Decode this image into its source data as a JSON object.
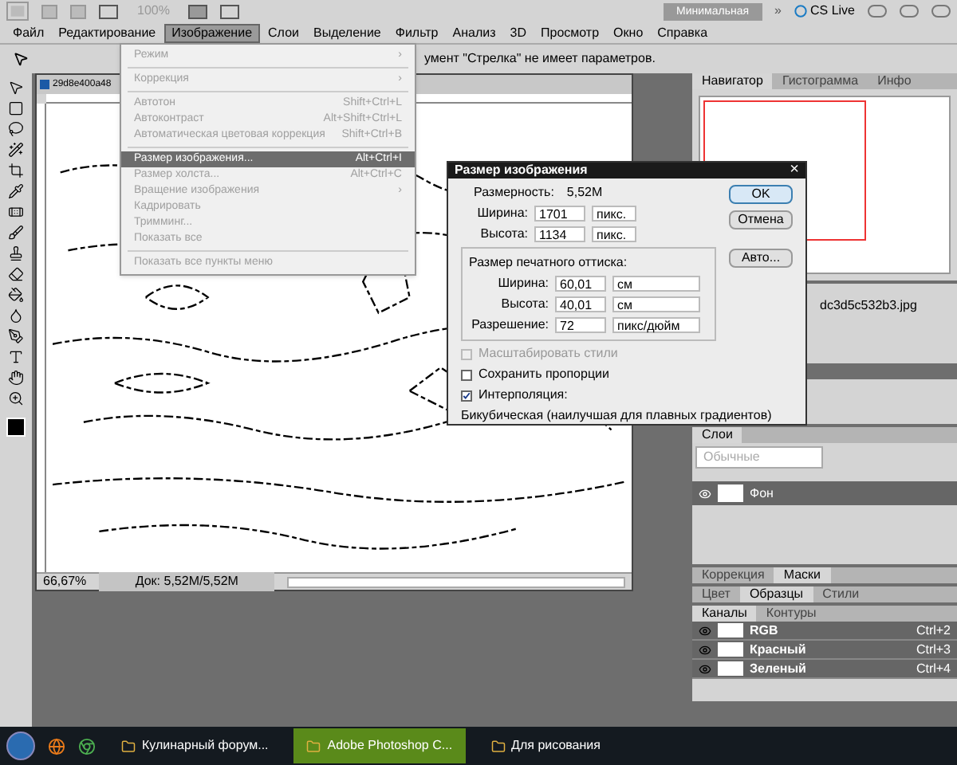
{
  "app_bar": {
    "zoom": "100%",
    "workspace_button": "Минимальная",
    "more": "»",
    "cs_live": "CS Live"
  },
  "menu_bar": [
    {
      "label": "Файл",
      "selected": false
    },
    {
      "label": "Редактирование",
      "selected": false
    },
    {
      "label": "Изображение",
      "selected": true
    },
    {
      "label": "Слои",
      "selected": false
    },
    {
      "label": "Выделение",
      "selected": false
    },
    {
      "label": "Фильтр",
      "selected": false
    },
    {
      "label": "Анализ",
      "selected": false
    },
    {
      "label": "3D",
      "selected": false
    },
    {
      "label": "Просмотр",
      "selected": false
    },
    {
      "label": "Окно",
      "selected": false
    },
    {
      "label": "Справка",
      "selected": false
    }
  ],
  "options_bar": {
    "hint": "умент \"Стрелка\" не имеет параметров."
  },
  "image_menu": [
    {
      "kind": "item",
      "label": "Режим",
      "shortcut": "›",
      "disabled": true,
      "selected": false
    },
    {
      "kind": "separator"
    },
    {
      "kind": "item",
      "label": "Коррекция",
      "shortcut": "›",
      "disabled": true,
      "selected": false
    },
    {
      "kind": "separator"
    },
    {
      "kind": "item",
      "label": "Автотон",
      "shortcut": "Shift+Ctrl+L",
      "disabled": true,
      "selected": false
    },
    {
      "kind": "item",
      "label": "Автоконтраст",
      "shortcut": "Alt+Shift+Ctrl+L",
      "disabled": true,
      "selected": false
    },
    {
      "kind": "item",
      "label": "Автоматическая цветовая коррекция",
      "shortcut": "Shift+Ctrl+B",
      "disabled": true,
      "selected": false
    },
    {
      "kind": "separator"
    },
    {
      "kind": "item",
      "label": "Размер изображения...",
      "shortcut": "Alt+Ctrl+I",
      "disabled": false,
      "selected": true
    },
    {
      "kind": "item",
      "label": "Размер холста...",
      "shortcut": "Alt+Ctrl+C",
      "disabled": true,
      "selected": false
    },
    {
      "kind": "item",
      "label": "Вращение изображения",
      "shortcut": "›",
      "disabled": true,
      "selected": false
    },
    {
      "kind": "item",
      "label": "Кадрировать",
      "disabled": true,
      "selected": false
    },
    {
      "kind": "item",
      "label": "Тримминг...",
      "disabled": true,
      "selected": false
    },
    {
      "kind": "item",
      "label": "Показать все",
      "disabled": true,
      "selected": false
    },
    {
      "kind": "separator"
    },
    {
      "kind": "item",
      "label": "Показать все пункты меню",
      "disabled": true,
      "selected": false
    }
  ],
  "document": {
    "title": "29d8e400a48",
    "zoom": "66,67%",
    "doc_size": "Док: 5,52M/5,52M"
  },
  "dialog": {
    "title": "Размер изображения",
    "close": "×",
    "dimension_label": "Размерность:",
    "dimension_value": "5,52M",
    "pixel_fields": [
      {
        "label": "Ширина:",
        "value": "1701",
        "unit": "пикс."
      },
      {
        "label": "Высота:",
        "value": "1134",
        "unit": "пикс."
      }
    ],
    "print_group": "Размер печатного оттиска:",
    "print_fields": [
      {
        "label": "Ширина:",
        "value": "60,01",
        "unit": "см"
      },
      {
        "label": "Высота:",
        "value": "40,01",
        "unit": "см"
      },
      {
        "label": "Разрешение:",
        "value": "72",
        "unit": "пикс/дюйм"
      }
    ],
    "options": [
      {
        "label": "Масштабировать стили",
        "checked": false,
        "disabled": true
      },
      {
        "label": "Сохранить пропорции",
        "checked": false,
        "disabled": false
      },
      {
        "label": "Интерполяция:",
        "checked": true,
        "disabled": false
      }
    ],
    "method": "Бикубическая (наилучшая для плавных градиентов)",
    "buttons": [
      {
        "label": "OK",
        "default": true
      },
      {
        "label": "Отмена",
        "default": false
      },
      {
        "label": "Авто...",
        "default": false
      }
    ]
  },
  "navigator_tabs": [
    {
      "label": "Навигатор",
      "selected": true
    },
    {
      "label": "Гистограмма",
      "selected": false
    },
    {
      "label": "Инфо",
      "selected": false
    }
  ],
  "history": {
    "item": "dc3d5c532b3.jpg"
  },
  "layers": {
    "tabs": [
      {
        "label": "Слои",
        "selected": true
      }
    ],
    "blend_mode": "Обычные",
    "rows": [
      {
        "name": "Фон",
        "selected": true
      }
    ]
  },
  "adjust_tabs": [
    {
      "label": "Коррекция",
      "selected": false
    },
    {
      "label": "Маски",
      "selected": true
    }
  ],
  "color_tabs": [
    {
      "label": "Цвет",
      "selected": false
    },
    {
      "label": "Образцы",
      "selected": true
    },
    {
      "label": "Стили",
      "selected": false
    }
  ],
  "channels": {
    "tabs": [
      {
        "label": "Каналы",
        "selected": true
      },
      {
        "label": "Контуры",
        "selected": false
      }
    ],
    "rows": [
      {
        "name": "RGB",
        "shortcut": "Ctrl+2"
      },
      {
        "name": "Красный",
        "shortcut": "Ctrl+3"
      },
      {
        "name": "Зеленый",
        "shortcut": "Ctrl+4"
      }
    ]
  },
  "taskbar": [
    {
      "label": "Кулинарный форум...",
      "selected": false
    },
    {
      "label": "Adobe Photoshop C...",
      "selected": true
    },
    {
      "label": "Для рисования",
      "selected": false
    }
  ]
}
